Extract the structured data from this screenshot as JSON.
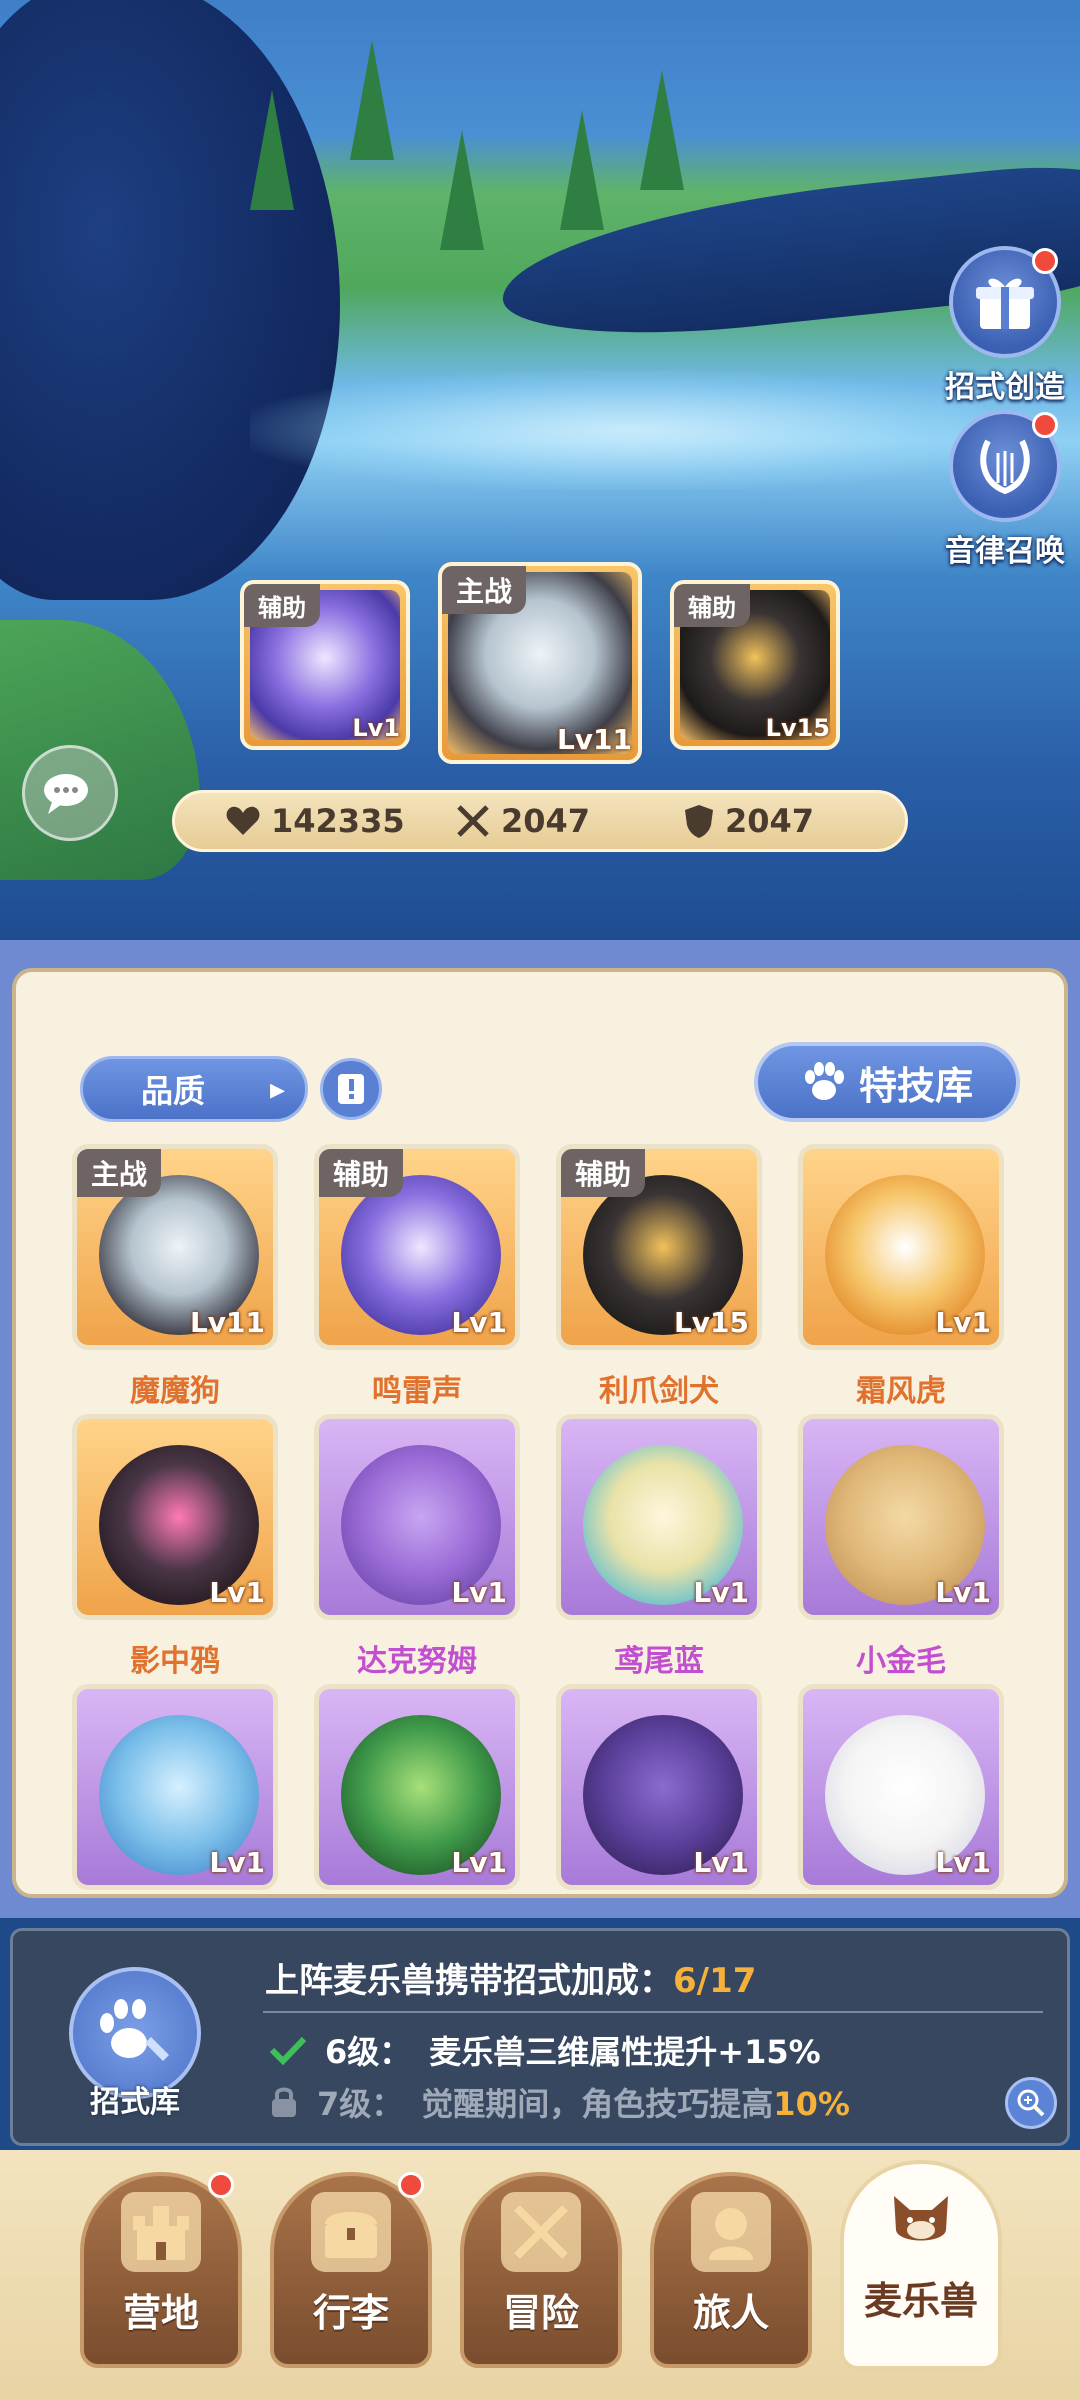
{
  "side_buttons": {
    "skill_create": {
      "label": "招式创造",
      "icon": "gift-music-icon"
    },
    "melody_summon": {
      "label": "音律召唤",
      "icon": "lyre-icon"
    }
  },
  "team": {
    "support_left": {
      "tag": "辅助",
      "level": "Lv1"
    },
    "main": {
      "tag": "主战",
      "level": "Lv11"
    },
    "support_right": {
      "tag": "辅助",
      "level": "Lv15"
    }
  },
  "stats": {
    "hp": "142335",
    "attack": "2047",
    "defense": "2047"
  },
  "filter": {
    "quality_label": "品质",
    "special_library_label": "特技库"
  },
  "pets": [
    {
      "name": "魔魔狗",
      "level": "Lv11",
      "tag": "主战",
      "rarity": "orange",
      "name_color": "#e0722e"
    },
    {
      "name": "鸣雷声",
      "level": "Lv1",
      "tag": "辅助",
      "rarity": "orange",
      "name_color": "#e0722e"
    },
    {
      "name": "利爪剑犬",
      "level": "Lv15",
      "tag": "辅助",
      "rarity": "orange",
      "name_color": "#e0722e"
    },
    {
      "name": "霜风虎",
      "level": "Lv1",
      "tag": "",
      "rarity": "orange",
      "name_color": "#e0722e"
    },
    {
      "name": "影中鸦",
      "level": "Lv1",
      "tag": "",
      "rarity": "orange",
      "name_color": "#e0722e"
    },
    {
      "name": "达克努姆",
      "level": "Lv1",
      "tag": "",
      "rarity": "purple",
      "name_color": "#c24fd0"
    },
    {
      "name": "鸢尾蓝",
      "level": "Lv1",
      "tag": "",
      "rarity": "purple",
      "name_color": "#c24fd0"
    },
    {
      "name": "小金毛",
      "level": "Lv1",
      "tag": "",
      "rarity": "purple",
      "name_color": "#c24fd0"
    },
    {
      "name": "",
      "level": "Lv1",
      "tag": "",
      "rarity": "purple",
      "name_color": "#c24fd0"
    },
    {
      "name": "",
      "level": "Lv1",
      "tag": "",
      "rarity": "purple",
      "name_color": "#c24fd0"
    },
    {
      "name": "",
      "level": "Lv1",
      "tag": "",
      "rarity": "purple",
      "name_color": "#c24fd0"
    },
    {
      "name": "",
      "level": "Lv1",
      "tag": "",
      "rarity": "purple",
      "name_color": "#c24fd0"
    }
  ],
  "bonus": {
    "title": "上阵麦乐兽携带招式加成：",
    "progress": "6/17",
    "line1_level": "6级：",
    "line1_text": "麦乐兽三维属性提升+15%",
    "line2_level": "7级：",
    "line2_text": "觉醒期间，角色技巧提高",
    "line2_pct": "10%",
    "library_label": "招式库"
  },
  "nav": [
    {
      "label": "营地",
      "icon": "castle-icon",
      "badge": true
    },
    {
      "label": "行李",
      "icon": "chest-icon",
      "badge": true
    },
    {
      "label": "冒险",
      "icon": "crossed-swords-icon",
      "badge": false
    },
    {
      "label": "旅人",
      "icon": "traveler-icon",
      "badge": false
    },
    {
      "label": "麦乐兽",
      "icon": "pet-cat-icon",
      "badge": false
    }
  ]
}
